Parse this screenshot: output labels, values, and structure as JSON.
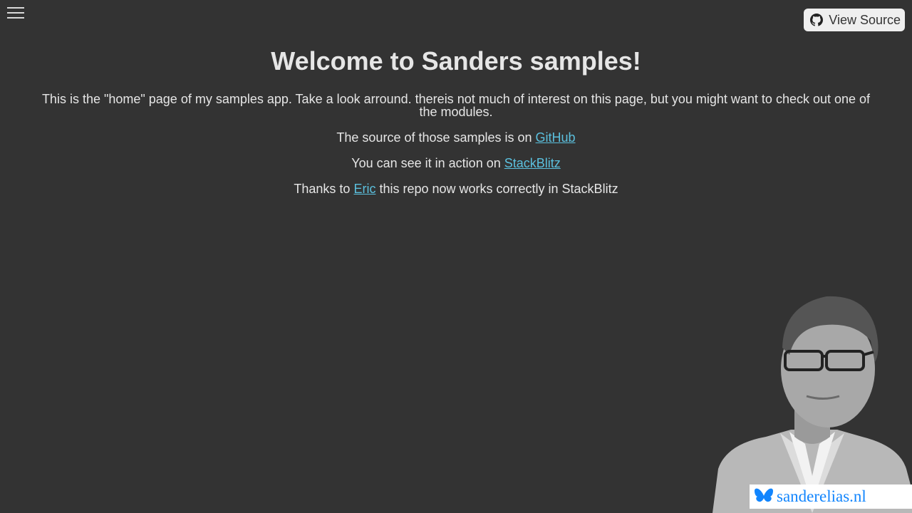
{
  "header": {
    "menu_icon": "hamburger-menu-icon",
    "view_source_label": "View Source",
    "view_source_icon": "github-icon"
  },
  "main": {
    "title": "Welcome to Sanders samples!",
    "intro": "This is the \"home\" page of my samples app. Take a look arround. thereis not much of interest on this page, but you might want to check out one of the modules.",
    "source_line": {
      "before": "The source of those samples is on ",
      "link": "GitHub"
    },
    "action_line": {
      "before": "You can see it in action on ",
      "link": "StackBlitz"
    },
    "thanks_line": {
      "before": "Thanks to ",
      "link": "Eric",
      "after": " this repo now works correctly in StackBlitz"
    }
  },
  "branding": {
    "badge_text": "sanderelias.nl",
    "badge_icon": "butterfly-icon",
    "badge_color": "#1185fe"
  }
}
